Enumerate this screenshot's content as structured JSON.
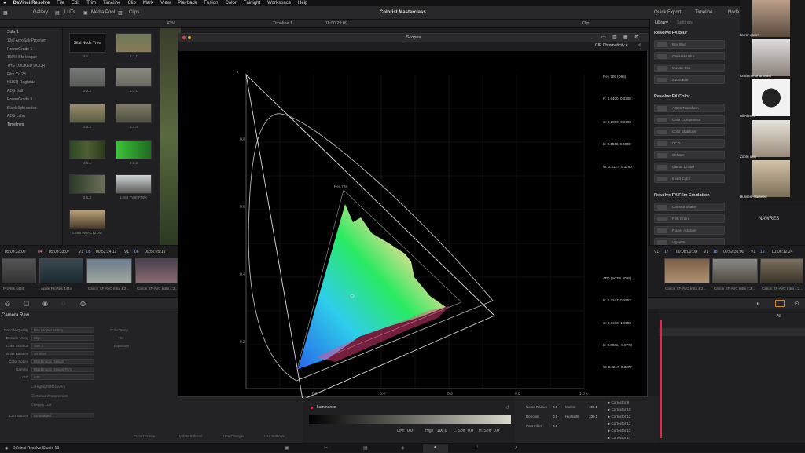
{
  "menubar": {
    "items": [
      "DaVinci Resolve",
      "File",
      "Edit",
      "Trim",
      "Timeline",
      "Clip",
      "Mark",
      "View",
      "Playback",
      "Fusion",
      "Color",
      "Fairlight",
      "Workspace",
      "Help"
    ]
  },
  "topbar": {
    "tabs": [
      "Gallery",
      "LUTs",
      "Media Pool",
      "Clips"
    ],
    "project": "Colorist Masterclass",
    "right_tabs": [
      "Quick Export",
      "Timeline",
      "Node"
    ]
  },
  "row2": {
    "zoom": "43%",
    "timeline": "Timeline 1",
    "timecode": "01:00:29:09",
    "clip": "Clip"
  },
  "sidebar": {
    "items": [
      "Stills 1",
      "13al AcroSak Program",
      "PowerGrade 1",
      "100% Sfa league",
      "THE LOCKED DOOR",
      "Film Yd 23",
      "HUSQ Raghdad",
      "ADS Bull",
      "PowerGrade 9",
      "Black light series",
      "ADS Lubn",
      "Timelines"
    ]
  },
  "stills": {
    "tiles": [
      {
        "label": "2.1.1",
        "title": "Sital Node Tree"
      },
      {
        "label": "2.2.1"
      },
      {
        "label": "2.2.2"
      },
      {
        "label": "2.3.1"
      },
      {
        "label": "2.3.2"
      },
      {
        "label": "2.3.3"
      },
      {
        "label": "2.5.1"
      },
      {
        "label": "2.5.2"
      },
      {
        "label": "2.5.3"
      },
      {
        "label": "LS68 TVB0FN2K"
      },
      {
        "label": "LS68 W0ACTZDM"
      }
    ]
  },
  "scopes": {
    "title": "Scopes",
    "mode": "CIE Chromaticity",
    "gamut_top": "Rec.709 (D65)",
    "r1": "R: 0.6400, 0.3300",
    "g1": "G: 0.3000, 0.6000",
    "b1": "B: 0.1500, 0.0600",
    "w1": "W: 0.3127, 0.3290",
    "gamut_bot": "AP0 (ACES 2065)",
    "r2": "R: 0.7347, 0.2653",
    "g2": "G: 0.0000, 1.0000",
    "b2": "B: 0.0001, -0.0770",
    "w2": "W: 0.3217, 0.3377",
    "axis_y": "y",
    "y_ticks": [
      "0.8",
      "0.6",
      "0.4",
      "0.2"
    ],
    "x_ticks": [
      "0.2",
      "0.4",
      "0.6",
      "0.8",
      "1.0 x"
    ],
    "rec_label": "Rec.709"
  },
  "rightpanel": {
    "tabs": [
      "Library",
      "Settings"
    ],
    "sections": [
      {
        "title": "Resolve FX Blur",
        "items": [
          "Box Blur",
          "Gaussian Blur",
          "Mosaic Blur",
          "Zoom Blur"
        ]
      },
      {
        "title": "Resolve FX Color",
        "items": [
          "ACES Transform",
          "Color Compressor",
          "Color Stabilizer",
          "DCTL",
          "Dehaze",
          "Gamut Limiter",
          "Invert Color"
        ]
      },
      {
        "title": "Resolve FX Film Emulation",
        "items": [
          "Camera Shake",
          "Film Grain",
          "Flicker Addition",
          "Vignette"
        ]
      }
    ]
  },
  "videocall": {
    "participants": [
      {
        "name": "karrar qasim"
      },
      {
        "name": "ibrahim mohammed"
      },
      {
        "name": "Ali Ahmed"
      },
      {
        "name": "Zoom user"
      },
      {
        "name": "Hussein Hameed"
      }
    ],
    "tile_name": "NAWRES"
  },
  "timeline": {
    "timecodes": [
      "05:03:32:00",
      "04",
      "05:03:33:07",
      "V1",
      "05",
      "00:52:24:12",
      "V1",
      "06",
      "00:52:25:19",
      "V1",
      "17",
      "00:08:00:09",
      "V1",
      "18",
      "00:52:31:00",
      "V1",
      "19",
      "01:06:12:24"
    ],
    "clips": [
      "ProRes 4444",
      "Apple ProRes 4444",
      "Canon XF-AVC Intra 4:2...",
      "Canon XF-AVC Intra 4:2...",
      "Canon XF-AVC Intra 4:2...",
      "Canon XF-AVC Intra 4:2...",
      "Canon XF-AVC Intra 4:2..."
    ]
  },
  "raw": {
    "title": "Camera Raw",
    "fields": [
      {
        "label": "Decode Quality",
        "value": "Use project setting"
      },
      {
        "label": "Decode Using",
        "value": "Clip"
      },
      {
        "label": "Color Science",
        "value": "Gen 1"
      },
      {
        "label": "White Balance",
        "value": "As Shot"
      },
      {
        "label": "Color Space",
        "value": "Blackmagic Design"
      },
      {
        "label": "Gamma",
        "value": "Blackmagic Design Film"
      },
      {
        "label": "ISO",
        "value": "640"
      }
    ],
    "checks": [
      "Highlight Recovery",
      "Gamut Compression",
      "Apply LUT"
    ],
    "lut": {
      "label": "LUT Source",
      "value": "Embedded"
    },
    "buttons": [
      "Export Frame",
      "Update Sidecar",
      "Use Changes",
      "Use Settings"
    ],
    "right": [
      "Color Temp",
      "Tint",
      "Exposure"
    ]
  },
  "luminance": {
    "title": "Luminance",
    "low": "Low",
    "low_v": "0.0",
    "high": "High",
    "high_v": "100.0",
    "ls": "L. Soft",
    "ls_v": "0.0",
    "hs": "H. Soft",
    "hs_v": "0.0"
  },
  "motion": {
    "rows": [
      [
        "Noise Radius",
        "0.0",
        "Motion",
        "100.0"
      ],
      [
        "Denoise",
        "0.0",
        "Highlight",
        "100.0"
      ],
      [
        "Post Filter",
        "0.0"
      ]
    ]
  },
  "correctors": {
    "items": [
      "Corrector 9",
      "Corrector 10",
      "Corrector 11",
      "Corrector 12",
      "Corrector 13",
      "Corrector 14"
    ]
  },
  "kf": {
    "label": "All"
  },
  "status": {
    "app": "DaVinci Resolve Studio 19"
  }
}
